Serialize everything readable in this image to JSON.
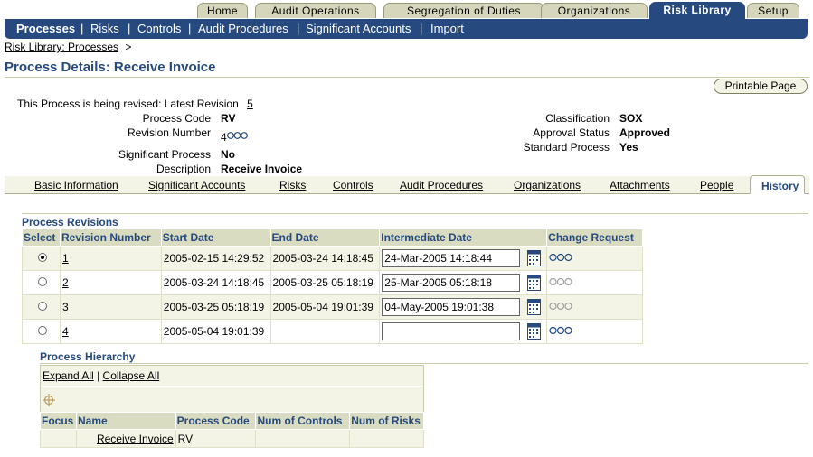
{
  "tabs": [
    "Home",
    "Audit Operations",
    "Segregation of Duties",
    "Organizations",
    "Risk Library",
    "Setup"
  ],
  "subnav": [
    "Processes",
    "Risks",
    "Controls",
    "Audit Procedures",
    "Significant Accounts",
    "Import"
  ],
  "breadcrumb": {
    "link": "Risk Library: Processes",
    "sep": ">"
  },
  "page_title": "Process Details: Receive Invoice",
  "printable_label": "Printable Page",
  "details": {
    "revision_note": "This Process is being revised: Latest Revision",
    "latest_revision": "5",
    "process_code_label": "Process Code",
    "process_code": "RV",
    "revision_number_label": "Revision Number",
    "revision_number": "4",
    "significant_label": "Significant Process",
    "significant": "No",
    "description_label": "Description",
    "description": "Receive Invoice",
    "classification_label": "Classification",
    "classification": "SOX",
    "approval_label": "Approval Status",
    "approval": "Approved",
    "standard_label": "Standard Process",
    "standard": "Yes"
  },
  "subtabs": [
    "Basic Information",
    "Significant Accounts",
    "Risks",
    "Controls",
    "Audit Procedures",
    "Organizations",
    "Attachments",
    "People",
    "History"
  ],
  "revisions": {
    "title": "Process Revisions",
    "columns": [
      "Select",
      "Revision Number",
      "Start Date",
      "End Date",
      "Intermediate Date",
      "Change Request"
    ],
    "rows": [
      {
        "rev": "1",
        "start": "2005-02-15 14:29:52",
        "end": "2005-03-24 14:18:45",
        "inter": "24-Mar-2005 14:18:44"
      },
      {
        "rev": "2",
        "start": "2005-03-24 14:18:45",
        "end": "2005-03-25 05:18:19",
        "inter": "25-Mar-2005 05:18:18"
      },
      {
        "rev": "3",
        "start": "2005-03-25 05:18:19",
        "end": "2005-05-04 19:01:39",
        "inter": "04-May-2005 19:01:38"
      },
      {
        "rev": "4",
        "start": "2005-05-04 19:01:39",
        "end": "",
        "inter": ""
      }
    ]
  },
  "hierarchy": {
    "title": "Process Hierarchy",
    "expand": "Expand All",
    "bar": "|",
    "collapse": "Collapse All",
    "columns": [
      "Focus",
      "Name",
      "Process Code",
      "Num of Controls",
      "Num of Risks"
    ],
    "row": {
      "name": "Receive Invoice",
      "code": "RV"
    }
  },
  "colors": {
    "navy": "#264a7f",
    "tab": "#d6d6bc",
    "header_bg": "#d9dcc0"
  }
}
